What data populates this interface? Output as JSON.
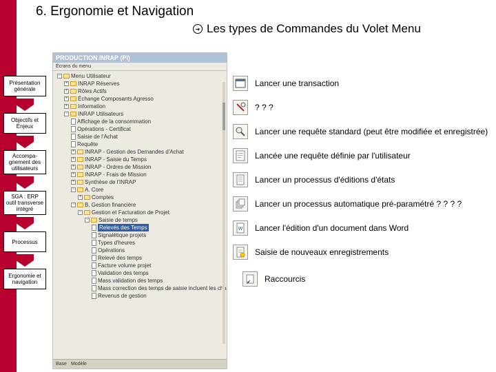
{
  "title": "6. Ergonomie et Navigation",
  "subtitle": "Les types de Commandes du Volet Menu",
  "sidebar": {
    "items": [
      {
        "label": "Présentation générale"
      },
      {
        "label": "Objectifs et Enjeux"
      },
      {
        "label": "Accompa-gnement des utilisateurs"
      },
      {
        "label": "SGA : ERP outil transverse intégré"
      },
      {
        "label": "Processus"
      },
      {
        "label": "Ergonomie et navigation"
      }
    ]
  },
  "app": {
    "title": "PRODUCTION INRAP (PI)",
    "menu_header": "Écrans du menu",
    "root": "Menu Utilisateur",
    "nodes": [
      "INRAP Réserves",
      "Rôles Actifs",
      "Échange Composants Agresso",
      "Information"
    ],
    "main_node": "INRAP Utilisateurs",
    "subnodes": [
      "Affichage de la consommation",
      "Opérations - Certificat",
      "Saisie de l'Achat",
      "Requête",
      "INRAP - Gestion des Demandes d'Achat",
      "INRAP - Saisie du Temps",
      "INRAP - Ordres de Mission",
      "INRAP - Frais de Mission",
      "Synthèse de l'INRAP"
    ],
    "core_folder": "A. Core",
    "finance_folder": "B. Gestion financière",
    "gfp": "Gestion et Facturation de Projet",
    "saisie": "Saisie de temps",
    "selected_row": "Relevés des Temps",
    "leafs": [
      "Comptes",
      "Signalétique projets",
      "Types d'heures",
      "Opérations",
      "Relevé des temps",
      "Facture volume projet",
      "Validation des temps",
      "Mass validation des temps",
      "Mass correction des temps de saisie incluent les charges",
      "Revenus de gestion"
    ],
    "bottom_tabs": [
      "Base",
      "Modèle"
    ]
  },
  "legend": {
    "items": [
      {
        "label": "Lancer une transaction"
      },
      {
        "label": "? ? ?"
      },
      {
        "label": "Lancer une requête standard (peut être modifiée et enregistrée)"
      },
      {
        "label": "Lancée une requête définie par l'utilisateur"
      },
      {
        "label": "Lancer un processus d'éditions d'états"
      },
      {
        "label": "Lancer  un processus automatique pré-paramétré ? ? ? ?"
      },
      {
        "label": "Lancer l'édition d'un document dans Word"
      },
      {
        "label": "Saisie de nouveaux enregistrements"
      }
    ],
    "shortcut_label": "Raccourcis"
  }
}
